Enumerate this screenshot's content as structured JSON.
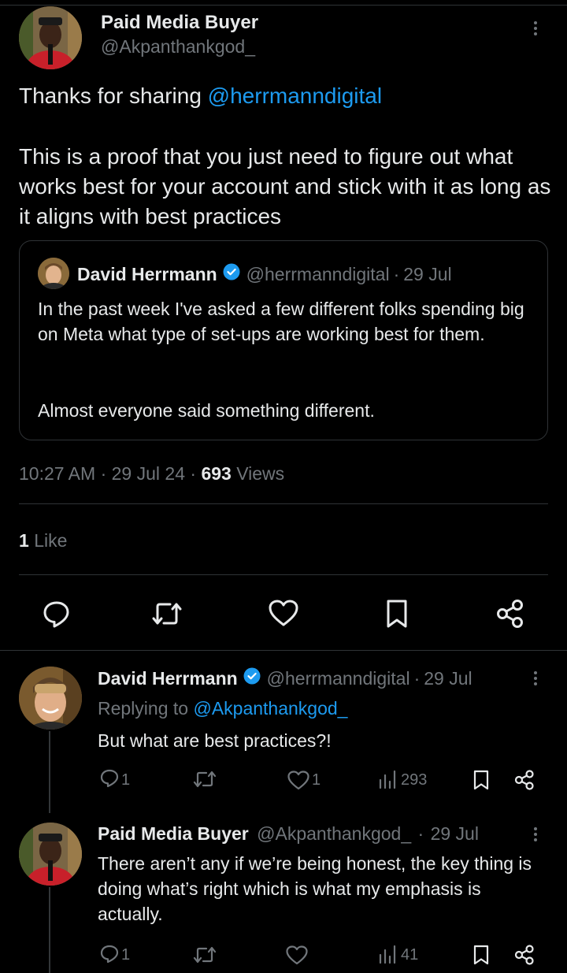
{
  "main_tweet": {
    "author_name": "Paid Media Buyer",
    "author_handle": "@Akpanthankgod_",
    "text_prefix": "Thanks for sharing ",
    "mention": "@herrmanndigital",
    "body": "This is a proof that you just need to figure out what works best for your account and stick with it as long as it aligns with best practices",
    "time": "10:27 AM",
    "date": "29 Jul 24",
    "views_count": "693",
    "views_label": "Views",
    "likes_count": "1",
    "likes_label": "Like"
  },
  "quoted_tweet": {
    "author_name": "David Herrmann",
    "author_handle": "@herrmanndigital",
    "date": "29 Jul",
    "paragraph1": "In the past week I've asked a few different folks spending big on Meta what type of set-ups are working best for them.",
    "paragraph2": "Almost everyone said something different."
  },
  "replies": [
    {
      "author_name": "David Herrmann",
      "author_handle": "@herrmanndigital",
      "date": "29 Jul",
      "replying_to_label": "Replying to",
      "replying_to_handle": "@Akpanthankgod_",
      "text": "But what are best practices?!",
      "reply_count": "1",
      "like_count": "1",
      "views": "293"
    },
    {
      "author_name": "Paid Media Buyer",
      "author_handle": "@Akpanthankgod_",
      "date": "29 Jul",
      "text": "There aren’t any if we’re being honest, the key thing is doing what’s right which is what my emphasis is actually.",
      "reply_count": "1",
      "views": "41"
    }
  ],
  "separator": "·",
  "colors": {
    "background": "#000000",
    "text": "#e7e9ea",
    "muted": "#71767b",
    "link": "#1d9bf0",
    "border": "#2f3336",
    "verified": "#1d9bf0"
  },
  "icons": [
    "more-icon",
    "verified-icon",
    "reply-icon",
    "retweet-icon",
    "like-icon",
    "bookmark-icon",
    "share-icon",
    "views-icon"
  ]
}
